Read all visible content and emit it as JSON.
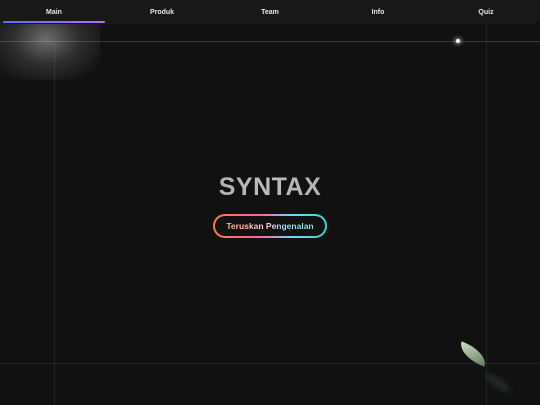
{
  "nav": {
    "items": [
      {
        "label": "Main"
      },
      {
        "label": "Produk"
      },
      {
        "label": "Team"
      },
      {
        "label": "Info"
      },
      {
        "label": "Quiz"
      }
    ]
  },
  "hero": {
    "title": "SYNTAX",
    "cta_label": "Teruskan Pengenalan"
  },
  "colors": {
    "background": "#111111",
    "nav_active_underline": "#8a6cff",
    "cta_gradient_start": "#ff7a45",
    "cta_gradient_end": "#3fd1c8"
  }
}
